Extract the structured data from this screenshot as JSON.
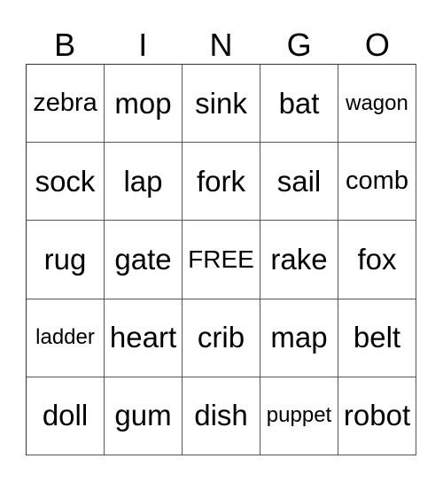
{
  "header": [
    "B",
    "I",
    "N",
    "G",
    "O"
  ],
  "cells": [
    [
      "zebra",
      "mop",
      "sink",
      "bat",
      "wagon"
    ],
    [
      "sock",
      "lap",
      "fork",
      "sail",
      "comb"
    ],
    [
      "rug",
      "gate",
      "FREE",
      "rake",
      "fox"
    ],
    [
      "ladder",
      "heart",
      "crib",
      "map",
      "belt"
    ],
    [
      "doll",
      "gum",
      "dish",
      "puppet",
      "robot"
    ]
  ]
}
